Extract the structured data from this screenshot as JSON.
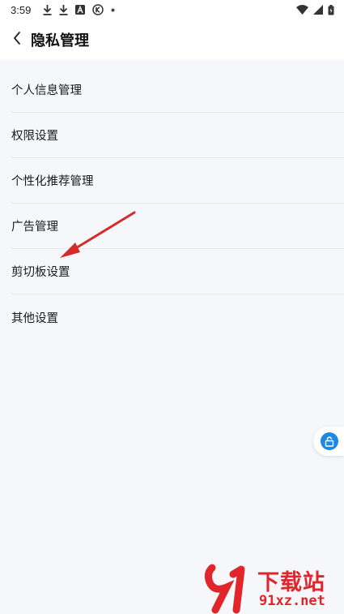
{
  "status_bar": {
    "time": "3:59",
    "icons": [
      "download-icon",
      "download-icon",
      "app-a-icon",
      "k-circle-icon",
      "dot-icon"
    ],
    "right_icons": [
      "wifi-icon",
      "signal-icon",
      "battery-icon"
    ]
  },
  "header": {
    "back_icon": "chevron-left-icon",
    "title": "隐私管理"
  },
  "menu": {
    "items": [
      {
        "label": "个人信息管理"
      },
      {
        "label": "权限设置"
      },
      {
        "label": "个性化推荐管理"
      },
      {
        "label": "广告管理"
      },
      {
        "label": "剪切板设置"
      },
      {
        "label": "其他设置"
      }
    ]
  },
  "floating_button": {
    "icon": "unlock-icon",
    "color": "#1e88e5"
  },
  "watermark": {
    "logo": "91-logo",
    "text": "下载站",
    "sub": "91xz.net",
    "color": "#e0252b"
  },
  "annotation": {
    "color": "#d62b2b",
    "points_to": "剪切板设置"
  }
}
